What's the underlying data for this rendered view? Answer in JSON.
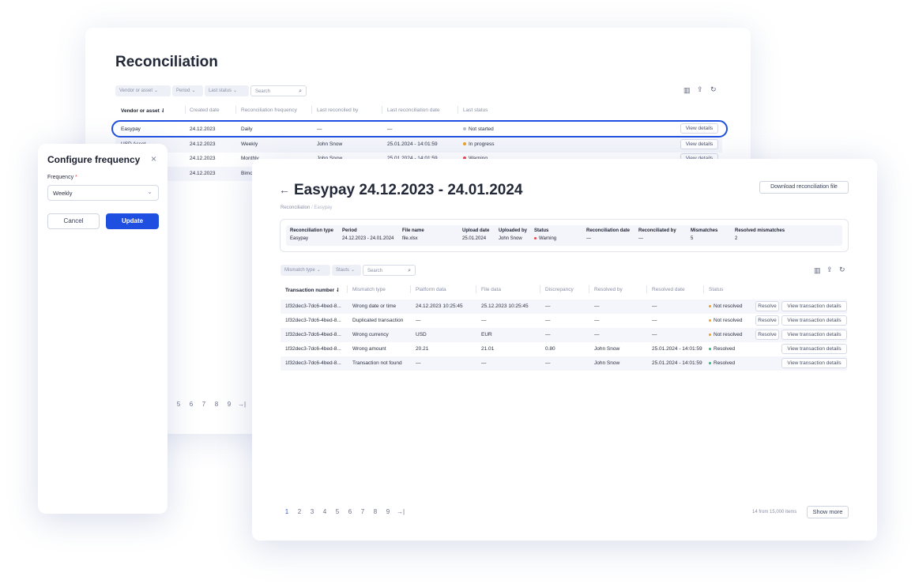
{
  "back": {
    "title": "Reconciliation",
    "filters": [
      "Vendor or asset",
      "Period",
      "Last status"
    ],
    "search_placeholder": "Search",
    "headers": [
      "Vendor or asset",
      "Created date",
      "Reconciliation frequency",
      "Last reconciled by",
      "Last reconciliation date",
      "Last status"
    ],
    "rows": [
      {
        "vendor": "Easypay",
        "created": "24.12.2023",
        "freq": "Daily",
        "by": "—",
        "date": "—",
        "status": "Not started",
        "action": "View details"
      },
      {
        "vendor": "USD Asset",
        "created": "24.12.2023",
        "freq": "Weekly",
        "by": "John Snow",
        "date": "25.01.2024 - 14:01:59",
        "status": "In progress",
        "action": "View details"
      },
      {
        "vendor": "",
        "created": "24.12.2023",
        "freq": "Monthly",
        "by": "John Snow",
        "date": "25.01.2024 - 14:01:59",
        "status": "Warning",
        "action": "View details"
      },
      {
        "vendor": "",
        "created": "24.12.2023",
        "freq": "Bimonthly",
        "by": "",
        "date": "",
        "status": "",
        "action": ""
      }
    ],
    "pager": [
      "5",
      "6",
      "7",
      "8",
      "9",
      "→|"
    ]
  },
  "modal": {
    "title": "Configure frequency",
    "close": "×",
    "field_label": "Frequency",
    "required_mark": "*",
    "value": "Weekly",
    "cancel": "Cancel",
    "update": "Update"
  },
  "front": {
    "back_arrow": "←",
    "title": "Easypay 24.12.2023 - 24.01.2024",
    "download": "Download reconciliation file",
    "breadcrumb": [
      "Reconciliation",
      "/",
      "Easypay"
    ],
    "summary": [
      {
        "label": "Reconciliation type",
        "value": "Easypay"
      },
      {
        "label": "Period",
        "value": "24.12.2023 - 24.01.2024"
      },
      {
        "label": "File name",
        "value": "file.xlsx"
      },
      {
        "label": "Upload date",
        "value": "25.01.2024"
      },
      {
        "label": "Uploaded by",
        "value": "John Snow"
      },
      {
        "label": "Status",
        "value": "Warning"
      },
      {
        "label": "Reconciliation date",
        "value": "—"
      },
      {
        "label": "Reconciliated by",
        "value": "—"
      },
      {
        "label": "Mismatches",
        "value": "5"
      },
      {
        "label": "Resolved mismatches",
        "value": "2"
      }
    ],
    "filters": [
      "Mismatch type",
      "Stauts"
    ],
    "search_placeholder": "Search",
    "headers": [
      "Transaction number",
      "Mismatch type",
      "Platform data",
      "File data",
      "Discrepancy",
      "Resolved by",
      "Resolved date",
      "Status"
    ],
    "rows": [
      {
        "tx": "1f32dec3-7dc6-4bed-8...",
        "type": "Wrong date or time",
        "platform": "24.12.2023 10:25:45",
        "file": "25.12.2023 10:25:45",
        "disc": "—",
        "by": "—",
        "date": "—",
        "status": "Not resolved",
        "resolve": "Resolve",
        "view": "View transaction details"
      },
      {
        "tx": "1f32dec3-7dc6-4bed-8...",
        "type": "Duplicated transaction",
        "platform": "—",
        "file": "—",
        "disc": "—",
        "by": "—",
        "date": "—",
        "status": "Not resolved",
        "resolve": "Resolve",
        "view": "View transaction details"
      },
      {
        "tx": "1f32dec3-7dc6-4bed-8...",
        "type": "Wrong currency",
        "platform": "USD",
        "file": "EUR",
        "disc": "—",
        "by": "—",
        "date": "—",
        "status": "Not resolved",
        "resolve": "Resolve",
        "view": "View transaction details"
      },
      {
        "tx": "1f32dec3-7dc6-4bed-8...",
        "type": "Wrong amount",
        "platform": "20.21",
        "file": "21.01",
        "disc": "0.80",
        "by": "John Snow",
        "date": "25.01.2024 - 14:01:59",
        "status": "Resolved",
        "resolve": "",
        "view": "View transaction details"
      },
      {
        "tx": "1f32dec3-7dc6-4bed-8...",
        "type": "Transaction not found",
        "platform": "—",
        "file": "—",
        "disc": "—",
        "by": "John Snow",
        "date": "25.01.2024 - 14:01:59",
        "status": "Resolved",
        "resolve": "",
        "view": "View transaction details"
      }
    ],
    "pager": [
      "1",
      "2",
      "3",
      "4",
      "5",
      "6",
      "7",
      "8",
      "9",
      "→|"
    ],
    "count": "14 from 15,000 items",
    "show_more": "Show more"
  },
  "colors": {
    "accent": "#1f4fe0",
    "warning": "#e5484d",
    "progress": "#f0a020",
    "resolved": "#2fb57a",
    "not_started": "#b7bccb"
  }
}
